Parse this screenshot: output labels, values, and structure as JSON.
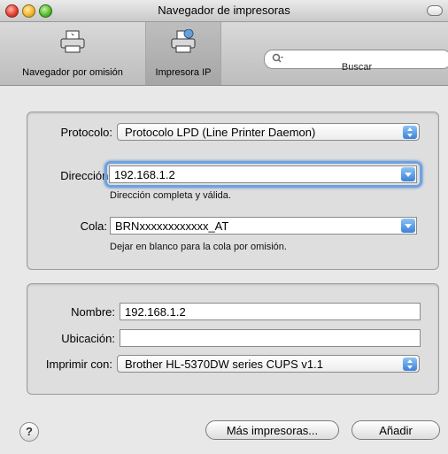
{
  "window": {
    "title": "Navegador de impresoras"
  },
  "toolbar": {
    "default_browser_label": "Navegador por omisión",
    "ip_printer_label": "Impresora IP",
    "search_label": "Buscar",
    "search_placeholder": ""
  },
  "form": {
    "protocol_label": "Protocolo:",
    "protocol_value": "Protocolo LPD (Line Printer Daemon)",
    "address_label": "Dirección:",
    "address_value": "192.168.1.2",
    "address_hint": "Dirección completa y válida.",
    "queue_label": "Cola:",
    "queue_value": "BRNxxxxxxxxxxxx_AT",
    "queue_hint": "Dejar en blanco para la cola por omisión."
  },
  "details": {
    "name_label": "Nombre:",
    "name_value": "192.168.1.2",
    "location_label": "Ubicación:",
    "location_value": "",
    "print_with_label": "Imprimir con:",
    "print_with_value": "Brother HL-5370DW series CUPS v1.1"
  },
  "footer": {
    "help_symbol": "?",
    "more_printers_label": "Más impresoras...",
    "add_label": "Añadir"
  },
  "icons": {
    "printer": "printer-icon",
    "ip_printer": "network-printer-icon",
    "search": "search-icon",
    "help": "help-icon"
  },
  "colors": {
    "accent": "#3b82d9",
    "focus": "#6ea2df"
  }
}
